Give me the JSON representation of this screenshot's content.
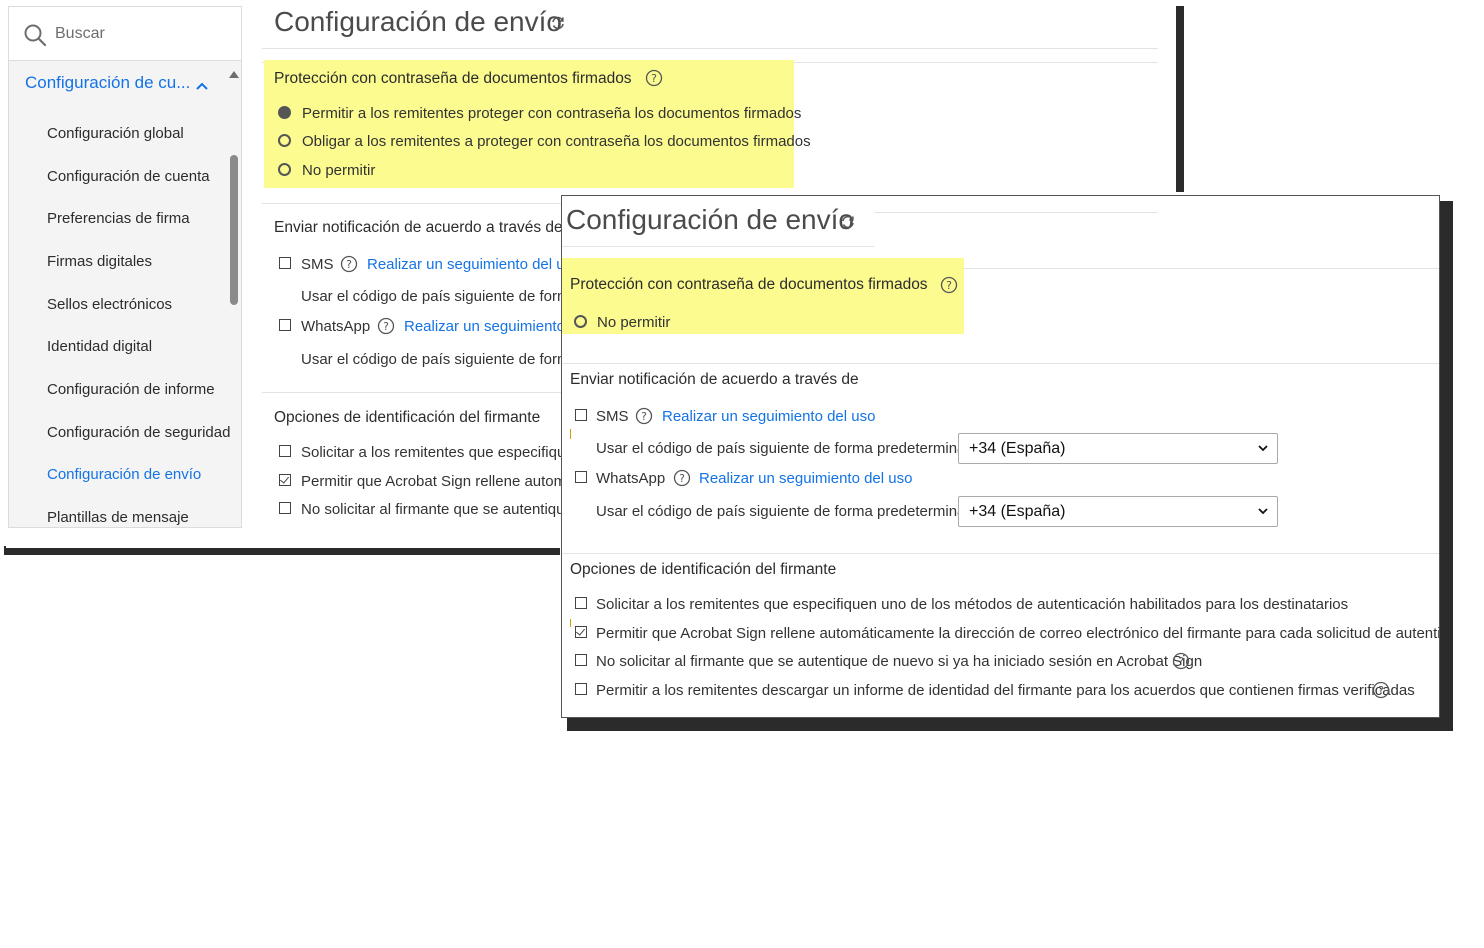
{
  "back": {
    "sidebar": {
      "search_placeholder": "Buscar",
      "account_header": "Configuración de cu...",
      "items": [
        {
          "label": "Configuración global"
        },
        {
          "label": "Configuración de cuenta"
        },
        {
          "label": "Preferencias de firma"
        },
        {
          "label": "Firmas digitales"
        },
        {
          "label": "Sellos electrónicos"
        },
        {
          "label": "Identidad digital"
        },
        {
          "label": "Configuración de informe"
        },
        {
          "label": "Configuración de seguridad"
        },
        {
          "label": "Configuración de envío",
          "active": true
        },
        {
          "label": "Plantillas de mensaje"
        }
      ]
    },
    "title": "Configuración de envío",
    "password_section": {
      "title": "Protección con contraseña de documentos firmados",
      "options": [
        {
          "label": "Permitir a los remitentes proteger con contraseña los documentos firmados",
          "selected": true
        },
        {
          "label": "Obligar a los remitentes a proteger con contraseña los documentos firmados",
          "selected": false
        },
        {
          "label": "No permitir",
          "selected": false
        }
      ]
    },
    "notify_section": {
      "title": "Enviar notificación de acuerdo a través de",
      "sms_label": "SMS",
      "sms_link": "Realizar un seguimiento del u",
      "sms_country_label": "Usar el código de país siguiente de form",
      "whatsapp_label": "WhatsApp",
      "whatsapp_link": "Realizar un seguimiento",
      "whatsapp_country_label": "Usar el código de país siguiente de form"
    },
    "id_section": {
      "title": "Opciones de identificación del firmante",
      "options": [
        {
          "label": "Solicitar a los remitentes que especifique",
          "checked": false
        },
        {
          "label": "Permitir que Acrobat Sign rellene autom",
          "checked": true
        },
        {
          "label": "No solicitar al firmante que se autentiqu",
          "checked": false
        }
      ]
    }
  },
  "front": {
    "title": "Configuración de envío",
    "password_section": {
      "title": "Protección con contraseña de documentos firmados",
      "option": "No permitir"
    },
    "notify_section": {
      "title": "Enviar notificación de acuerdo a través de",
      "sms_label": "SMS",
      "sms_link": "Realizar un seguimiento del uso",
      "sms_country_label": "Usar el código de país siguiente de forma predeterminada:",
      "sms_country_value": "+34 (España)",
      "whatsapp_label": "WhatsApp",
      "whatsapp_link": "Realizar un seguimiento del uso",
      "whatsapp_country_label": "Usar el código de país siguiente de forma predeterminada:",
      "whatsapp_country_value": "+34 (España)"
    },
    "id_section": {
      "title": "Opciones de identificación del firmante",
      "options": [
        {
          "label": "Solicitar a los remitentes que especifiquen uno de los métodos de autenticación habilitados para los destinatarios",
          "checked": false
        },
        {
          "label": "Permitir que Acrobat Sign rellene automáticamente la dirección de correo electrónico del firmante para cada solicitud de autenticación",
          "checked": true
        },
        {
          "label": "No solicitar al firmante que se autentique de nuevo si ya ha iniciado sesión en Acrobat Sign",
          "checked": false
        },
        {
          "label": "Permitir a los remitentes descargar un informe de identidad del firmante para los acuerdos que contienen firmas verificadas",
          "checked": false
        }
      ]
    }
  },
  "colors": {
    "accent": "#1473e6",
    "highlight": "#fbfb90"
  },
  "icons": [
    "search-icon",
    "chevron-up-icon",
    "refresh-icon",
    "help-icon",
    "chevron-down-icon"
  ]
}
